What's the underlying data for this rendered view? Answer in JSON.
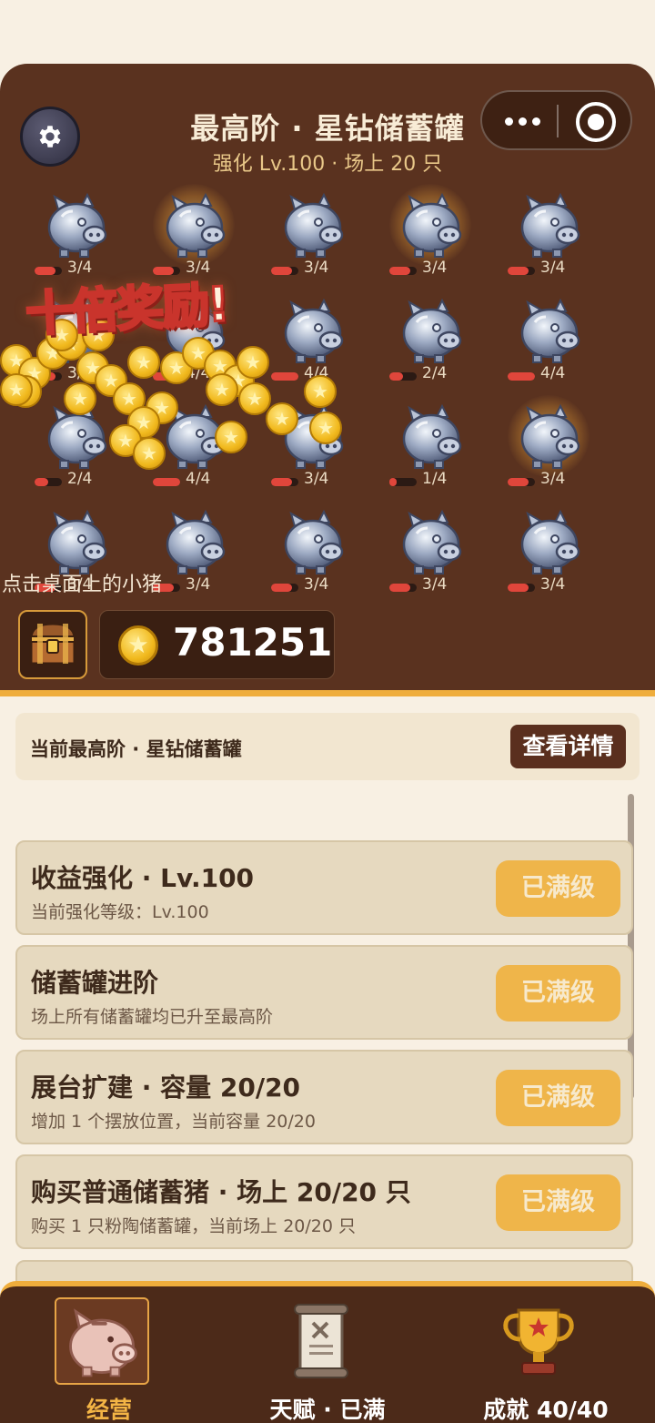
{
  "header": {
    "title": "最高阶 · 星钻储蓄罐",
    "subtitle": "强化 Lv.100 · 场上 20 只"
  },
  "capsule": {
    "more_icon": "more-dots-icon",
    "close_icon": "target-close-icon"
  },
  "settings_icon": "gear-icon",
  "reward_banner": "十倍奖励!",
  "pigs": [
    {
      "label": "3/4",
      "fill": 0.75,
      "glow": false
    },
    {
      "label": "3/4",
      "fill": 0.75,
      "glow": true
    },
    {
      "label": "3/4",
      "fill": 0.75,
      "glow": false
    },
    {
      "label": "3/4",
      "fill": 0.75,
      "glow": true
    },
    {
      "label": "3/4",
      "fill": 0.75,
      "glow": false
    },
    {
      "label": "3/4",
      "fill": 0.75,
      "glow": false
    },
    {
      "label": "4/4",
      "fill": 1.0,
      "glow": false
    },
    {
      "label": "4/4",
      "fill": 1.0,
      "glow": false
    },
    {
      "label": "2/4",
      "fill": 0.5,
      "glow": false
    },
    {
      "label": "4/4",
      "fill": 1.0,
      "glow": false
    },
    {
      "label": "2/4",
      "fill": 0.5,
      "glow": false
    },
    {
      "label": "4/4",
      "fill": 1.0,
      "glow": false
    },
    {
      "label": "3/4",
      "fill": 0.75,
      "glow": false
    },
    {
      "label": "1/4",
      "fill": 0.25,
      "glow": false
    },
    {
      "label": "3/4",
      "fill": 0.75,
      "glow": true
    },
    {
      "label": "3/4",
      "fill": 0.75,
      "glow": false
    },
    {
      "label": "3/4",
      "fill": 0.75,
      "glow": false
    },
    {
      "label": "3/4",
      "fill": 0.75,
      "glow": false
    },
    {
      "label": "3/4",
      "fill": 0.75,
      "glow": false
    },
    {
      "label": "3/4",
      "fill": 0.75,
      "glow": false
    }
  ],
  "hint": "点击桌面上的小猪",
  "coins": {
    "value": "781251",
    "icon": "star-coin-icon"
  },
  "chest_icon": "treasure-chest-icon",
  "current_tier": {
    "label": "当前最高阶 · 星钻储蓄罐",
    "detail_button": "查看详情"
  },
  "upgrades": [
    {
      "title": "收益强化 · Lv.100",
      "desc": "当前强化等级：Lv.100",
      "button": "已满级"
    },
    {
      "title": "储蓄罐进阶",
      "desc": "场上所有储蓄罐均已升至最高阶",
      "button": "已满级"
    },
    {
      "title": "展台扩建 · 容量 20/20",
      "desc": "增加 1 个摆放位置，当前容量 20/20",
      "button": "已满级"
    },
    {
      "title": "购买普通储蓄猪 · 场上 20/20 只",
      "desc": "购买 1 只粉陶储蓄罐，当前场上 20/20 只",
      "button": "已满级"
    }
  ],
  "nav": [
    {
      "label": "经营",
      "icon": "piggy-bank-icon",
      "active": true
    },
    {
      "label": "天赋 · 已满",
      "icon": "scroll-icon",
      "active": false
    },
    {
      "label": "成就 40/40",
      "icon": "trophy-icon",
      "active": false
    }
  ],
  "colors": {
    "panel_brown": "#5a321f",
    "gold_accent": "#efad3c",
    "maxed_button": "#efb54a",
    "bar_red": "#e0463b"
  }
}
